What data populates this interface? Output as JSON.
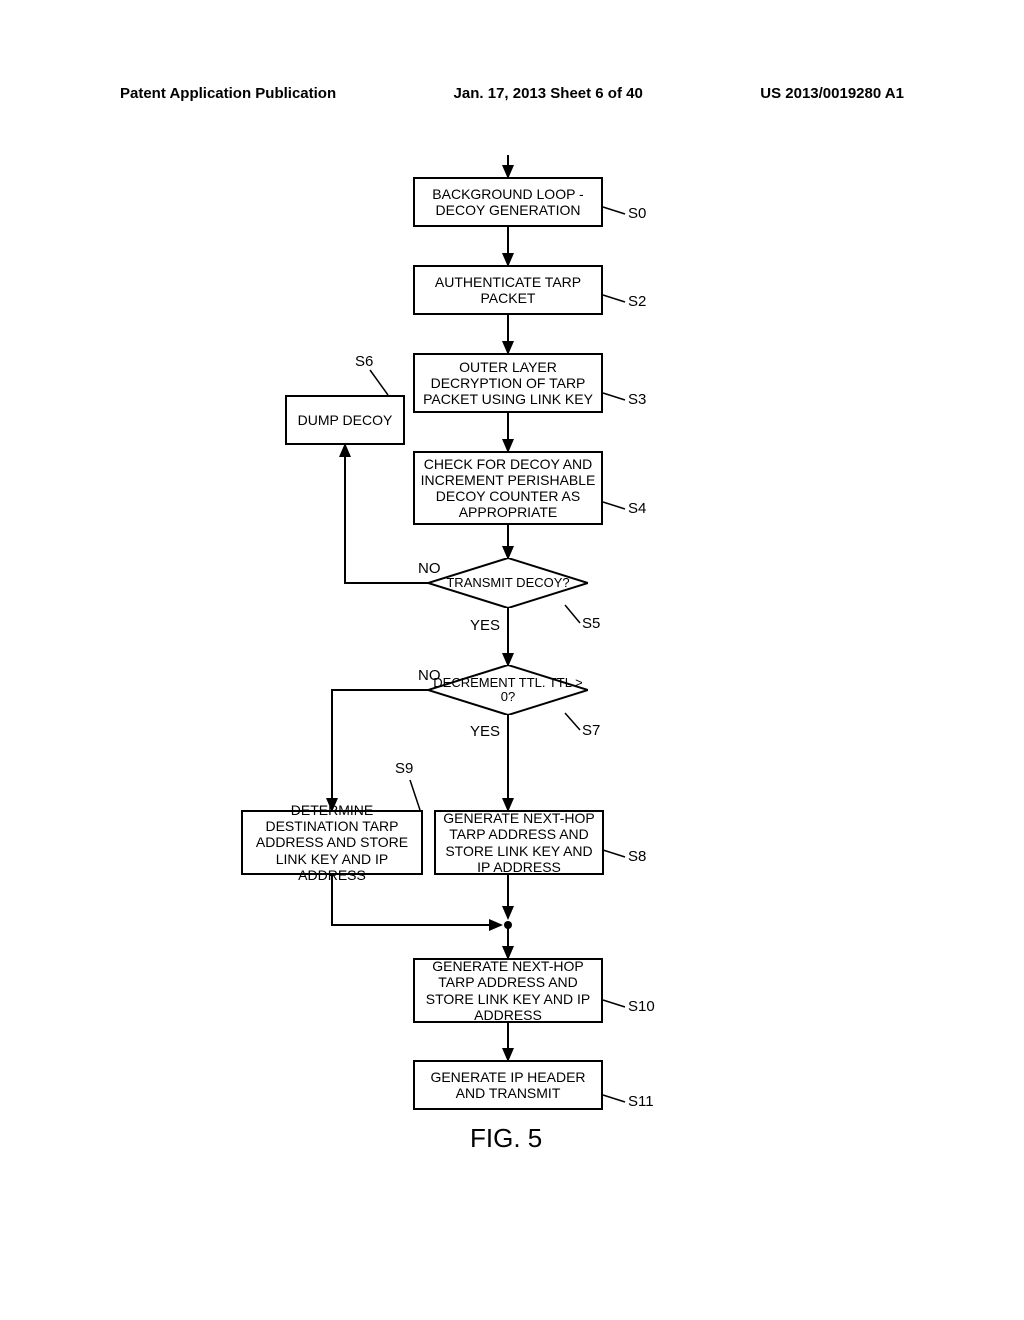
{
  "header": {
    "left": "Patent Application Publication",
    "center": "Jan. 17, 2013  Sheet 6 of 40",
    "right": "US 2013/0019280 A1"
  },
  "boxes": {
    "s0": "BACKGROUND LOOP - DECOY GENERATION",
    "s2": "AUTHENTICATE TARP PACKET",
    "s3": "OUTER LAYER DECRYPTION OF TARP PACKET USING LINK KEY",
    "s4": "CHECK FOR DECOY AND INCREMENT PERISHABLE DECOY COUNTER AS APPROPRIATE",
    "s6": "DUMP DECOY",
    "s8": "GENERATE NEXT-HOP TARP ADDRESS AND STORE LINK KEY AND IP ADDRESS",
    "s9": "DETERMINE DESTINATION TARP ADDRESS AND STORE LINK KEY AND IP ADDRESS",
    "s10": "GENERATE NEXT-HOP TARP ADDRESS AND STORE LINK KEY AND IP ADDRESS",
    "s11": "GENERATE IP HEADER AND TRANSMIT"
  },
  "diamonds": {
    "s5": "TRANSMIT DECOY?",
    "s7": "DECREMENT TTL. TTL > 0?"
  },
  "labels": {
    "s0": "S0",
    "s2": "S2",
    "s3": "S3",
    "s4": "S4",
    "s5": "S5",
    "s6": "S6",
    "s7": "S7",
    "s8": "S8",
    "s9": "S9",
    "s10": "S10",
    "s11": "S11",
    "yes": "YES",
    "no": "NO",
    "fig": "FIG. 5"
  },
  "chart_data": {
    "type": "flowchart",
    "title": "FIG. 5",
    "nodes": [
      {
        "id": "S0",
        "type": "process",
        "text": "BACKGROUND LOOP - DECOY GENERATION"
      },
      {
        "id": "S2",
        "type": "process",
        "text": "AUTHENTICATE TARP PACKET"
      },
      {
        "id": "S3",
        "type": "process",
        "text": "OUTER LAYER DECRYPTION OF TARP PACKET USING LINK KEY"
      },
      {
        "id": "S4",
        "type": "process",
        "text": "CHECK FOR DECOY AND INCREMENT PERISHABLE DECOY COUNTER AS APPROPRIATE"
      },
      {
        "id": "S5",
        "type": "decision",
        "text": "TRANSMIT DECOY?"
      },
      {
        "id": "S6",
        "type": "process",
        "text": "DUMP DECOY"
      },
      {
        "id": "S7",
        "type": "decision",
        "text": "DECREMENT TTL. TTL > 0?"
      },
      {
        "id": "S8",
        "type": "process",
        "text": "GENERATE NEXT-HOP TARP ADDRESS AND STORE LINK KEY AND IP ADDRESS"
      },
      {
        "id": "S9",
        "type": "process",
        "text": "DETERMINE DESTINATION TARP ADDRESS AND STORE LINK KEY AND IP ADDRESS"
      },
      {
        "id": "S10",
        "type": "process",
        "text": "GENERATE NEXT-HOP TARP ADDRESS AND STORE LINK KEY AND IP ADDRESS"
      },
      {
        "id": "S11",
        "type": "process",
        "text": "GENERATE IP HEADER AND TRANSMIT"
      }
    ],
    "edges": [
      {
        "from": "start",
        "to": "S0"
      },
      {
        "from": "S0",
        "to": "S2"
      },
      {
        "from": "S2",
        "to": "S3"
      },
      {
        "from": "S3",
        "to": "S4"
      },
      {
        "from": "S4",
        "to": "S5"
      },
      {
        "from": "S5",
        "to": "S6",
        "label": "NO"
      },
      {
        "from": "S5",
        "to": "S7",
        "label": "YES"
      },
      {
        "from": "S7",
        "to": "S9",
        "label": "NO"
      },
      {
        "from": "S7",
        "to": "S8",
        "label": "YES"
      },
      {
        "from": "S8",
        "to": "merge"
      },
      {
        "from": "S9",
        "to": "merge"
      },
      {
        "from": "merge",
        "to": "S10"
      },
      {
        "from": "S10",
        "to": "S11"
      }
    ]
  }
}
